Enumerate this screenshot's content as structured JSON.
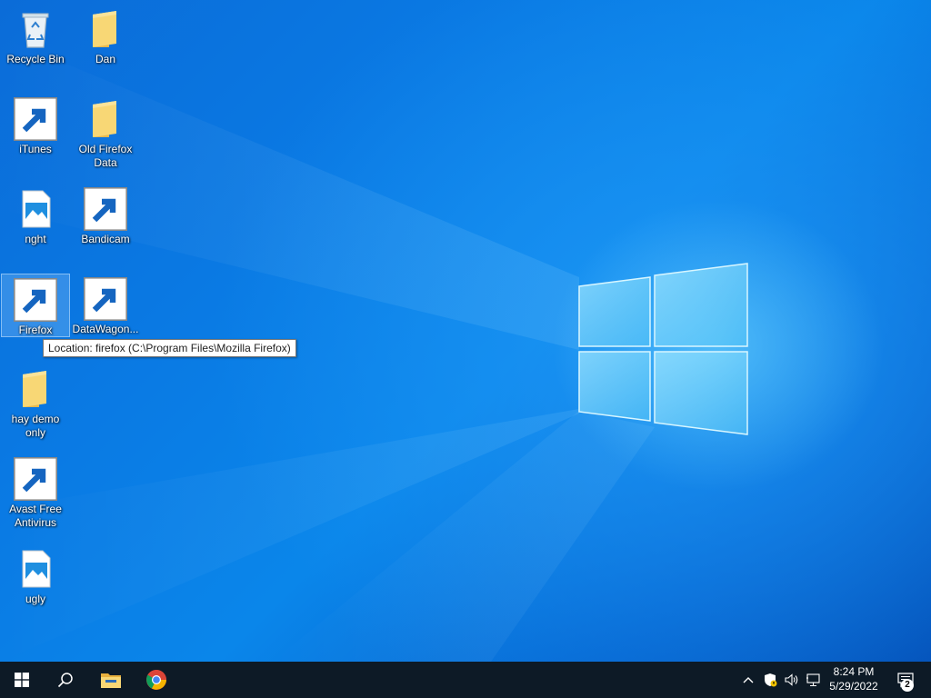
{
  "desktop": {
    "icons": [
      {
        "label": "Recycle Bin",
        "kind": "recycle-bin-icon"
      },
      {
        "label": "Dan",
        "kind": "folder-icon"
      },
      {
        "label": "iTunes",
        "kind": "itunes-icon",
        "shortcut": true
      },
      {
        "label": "Old Firefox\nData",
        "kind": "folder-icon"
      },
      {
        "label": "nght",
        "kind": "image-file-icon"
      },
      {
        "label": "Bandicam",
        "kind": "bandicam-icon",
        "shortcut": true
      },
      {
        "label": "Firefox",
        "kind": "firefox-icon",
        "shortcut": true,
        "selected": true
      },
      {
        "label": "DataWagon...",
        "kind": "datawagon-icon",
        "shortcut": true
      },
      {
        "label": "hay demo\nonly",
        "kind": "folder-icon"
      },
      {
        "label": "Avast Free\nAntivirus",
        "kind": "avast-icon",
        "shortcut": true
      },
      {
        "label": "ugly",
        "kind": "image-file-icon"
      }
    ],
    "tooltip": "Location: firefox (C:\\Program Files\\Mozilla Firefox)"
  },
  "taskbar": {
    "pinned": [
      {
        "name": "start-button",
        "icon": "windows-logo-icon"
      },
      {
        "name": "search-button",
        "icon": "search-icon"
      },
      {
        "name": "file-explorer-button",
        "icon": "file-explorer-icon"
      },
      {
        "name": "chrome-button",
        "icon": "chrome-icon"
      }
    ],
    "tray": {
      "icons": [
        "chevron-up-icon",
        "windows-security-icon",
        "volume-icon",
        "network-icon"
      ],
      "time": "8:24 PM",
      "date": "5/29/2022",
      "notification_count": "2"
    }
  },
  "colors": {
    "taskbar_bg": "#0d1a26",
    "wallpaper_accent": "#0a79e3",
    "tooltip_bg": "#ffffff"
  }
}
